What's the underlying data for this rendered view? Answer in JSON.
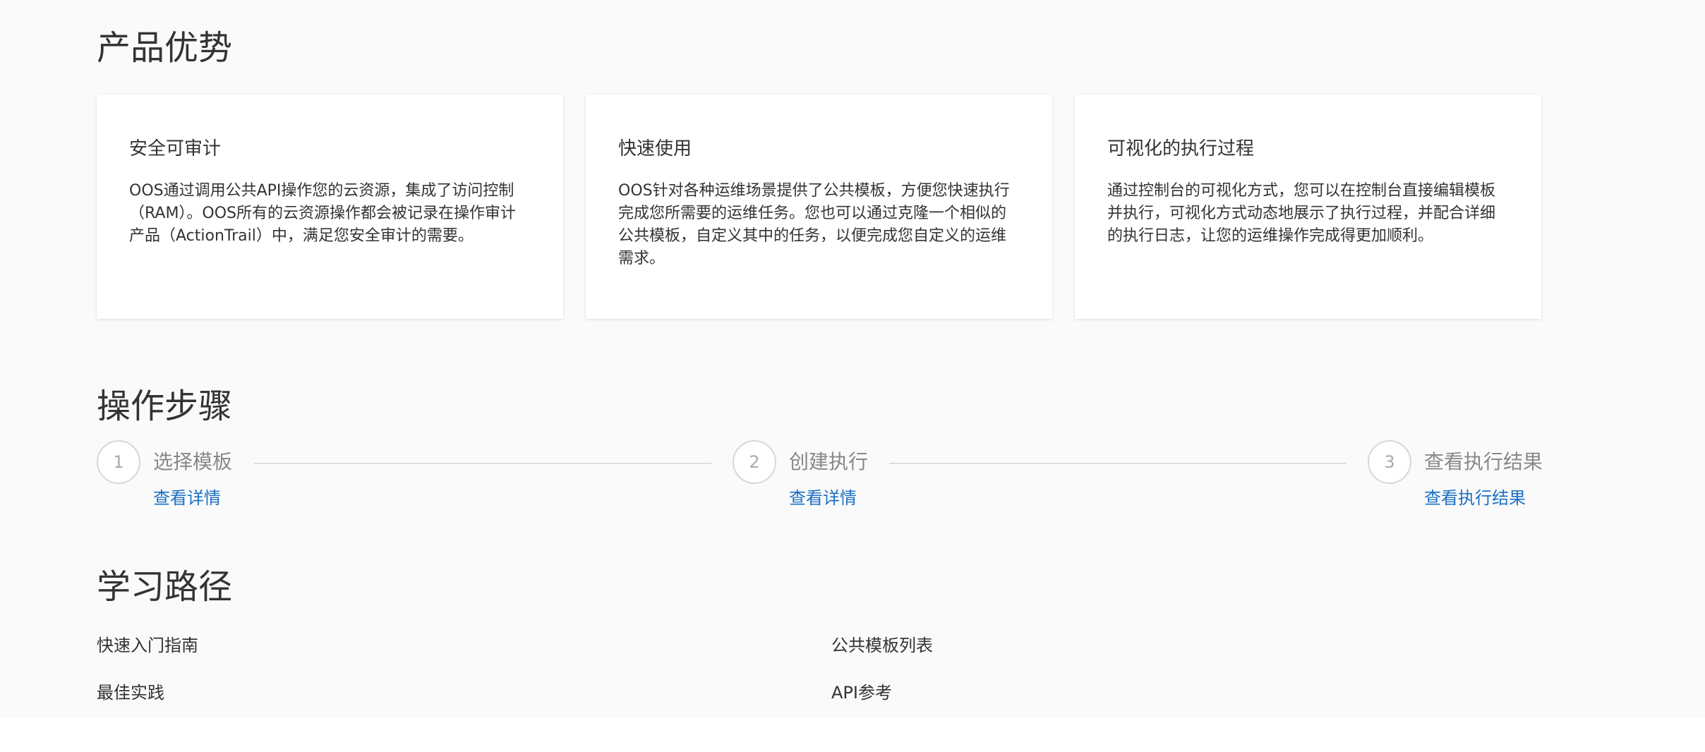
{
  "sections": {
    "advantages_title": "产品优势",
    "steps_title": "操作步骤",
    "learning_title": "学习路径"
  },
  "advantages": [
    {
      "title": "安全可审计",
      "desc": "OOS通过调用公共API操作您的云资源，集成了访问控制（RAM）。OOS所有的云资源操作都会被记录在操作审计产品（ActionTrail）中，满足您安全审计的需要。"
    },
    {
      "title": "快速使用",
      "desc": "OOS针对各种运维场景提供了公共模板，方便您快速执行完成您所需要的运维任务。您也可以通过克隆一个相似的公共模板，自定义其中的任务，以便完成您自定义的运维需求。"
    },
    {
      "title": "可视化的执行过程",
      "desc": "通过控制台的可视化方式，您可以在控制台直接编辑模板并执行，可视化方式动态地展示了执行过程，并配合详细的执行日志，让您的运维操作完成得更加顺利。"
    }
  ],
  "steps": [
    {
      "number": "1",
      "label": "选择模板",
      "link": "查看详情"
    },
    {
      "number": "2",
      "label": "创建执行",
      "link": "查看详情"
    },
    {
      "number": "3",
      "label": "查看执行结果",
      "link": "查看执行结果"
    }
  ],
  "learning": [
    {
      "label": "快速入门指南"
    },
    {
      "label": "公共模板列表"
    },
    {
      "label": "最佳实践"
    },
    {
      "label": "API参考"
    }
  ],
  "colors": {
    "link": "#1a6fc4",
    "background": "#fafafa",
    "card": "#ffffff"
  }
}
